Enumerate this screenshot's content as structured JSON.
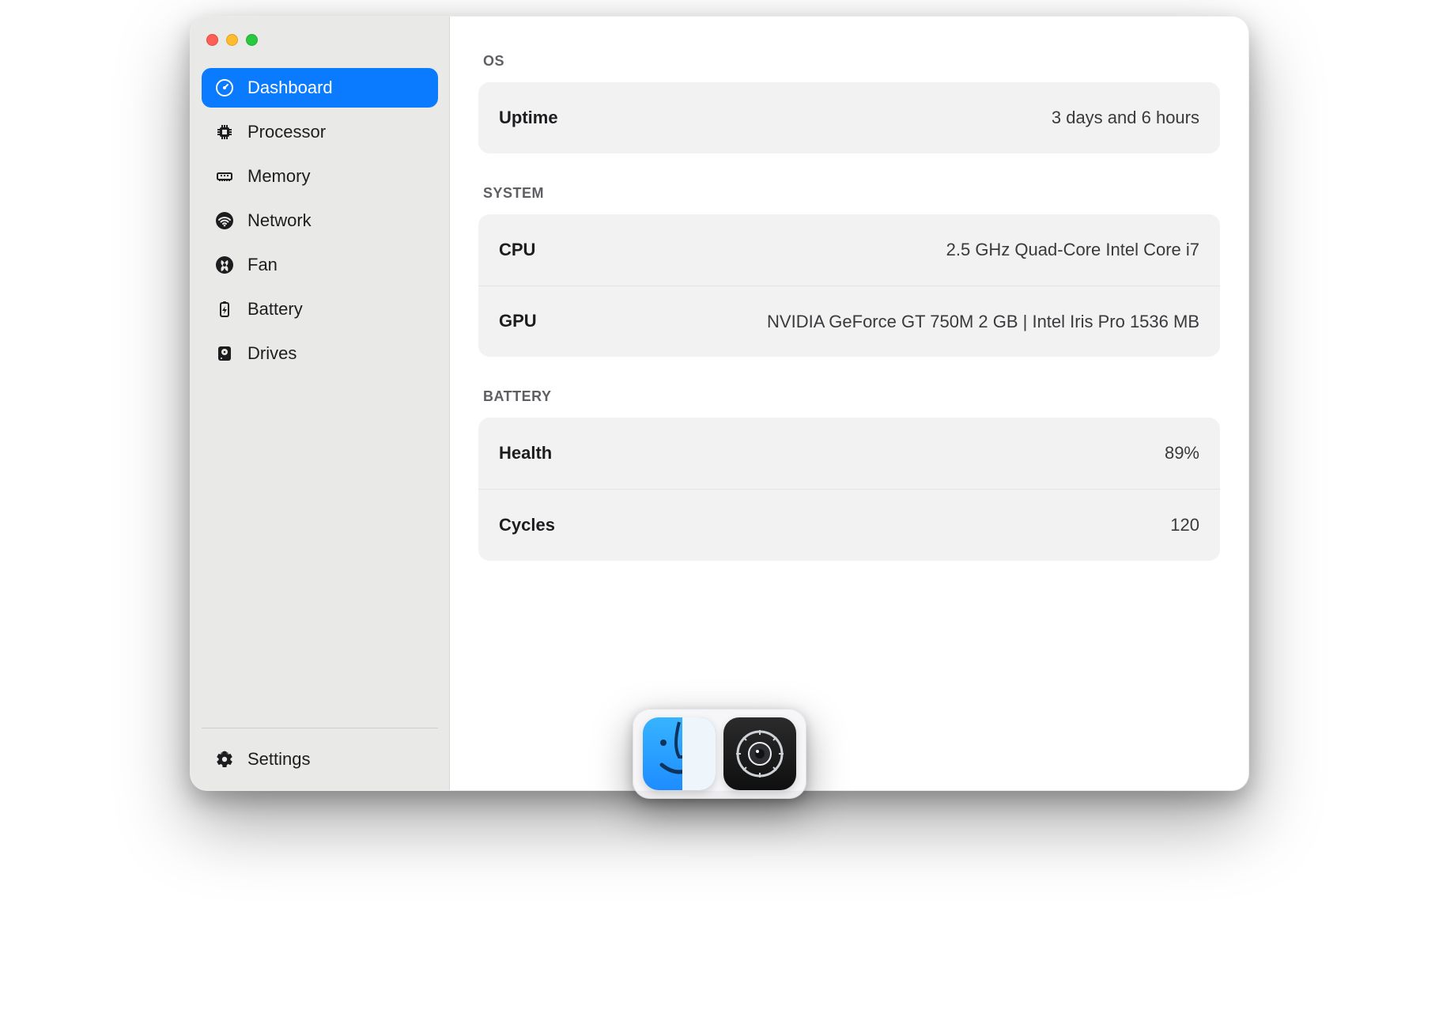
{
  "sidebar": {
    "items": [
      {
        "id": "dashboard",
        "label": "Dashboard",
        "icon": "gauge-icon",
        "selected": true
      },
      {
        "id": "processor",
        "label": "Processor",
        "icon": "cpu-icon",
        "selected": false
      },
      {
        "id": "memory",
        "label": "Memory",
        "icon": "memory-icon",
        "selected": false
      },
      {
        "id": "network",
        "label": "Network",
        "icon": "wifi-icon",
        "selected": false
      },
      {
        "id": "fan",
        "label": "Fan",
        "icon": "fan-icon",
        "selected": false
      },
      {
        "id": "battery",
        "label": "Battery",
        "icon": "battery-icon",
        "selected": false
      },
      {
        "id": "drives",
        "label": "Drives",
        "icon": "drive-icon",
        "selected": false
      }
    ],
    "settings_label": "Settings"
  },
  "sections": {
    "os": {
      "title": "OS",
      "rows": {
        "uptime": {
          "label": "Uptime",
          "value": "3 days and 6 hours"
        }
      }
    },
    "system": {
      "title": "SYSTEM",
      "rows": {
        "cpu": {
          "label": "CPU",
          "value": "2.5 GHz Quad-Core Intel Core i7"
        },
        "gpu": {
          "label": "GPU",
          "value": "NVIDIA GeForce GT 750M 2 GB | Intel Iris Pro 1536 MB"
        }
      }
    },
    "battery": {
      "title": "BATTERY",
      "rows": {
        "health": {
          "label": "Health",
          "value": "89%"
        },
        "cycles": {
          "label": "Cycles",
          "value": "120"
        }
      }
    }
  },
  "dock": {
    "items": [
      {
        "id": "finder",
        "name": "Finder"
      },
      {
        "id": "sysmon",
        "name": "System Monitor"
      }
    ]
  }
}
